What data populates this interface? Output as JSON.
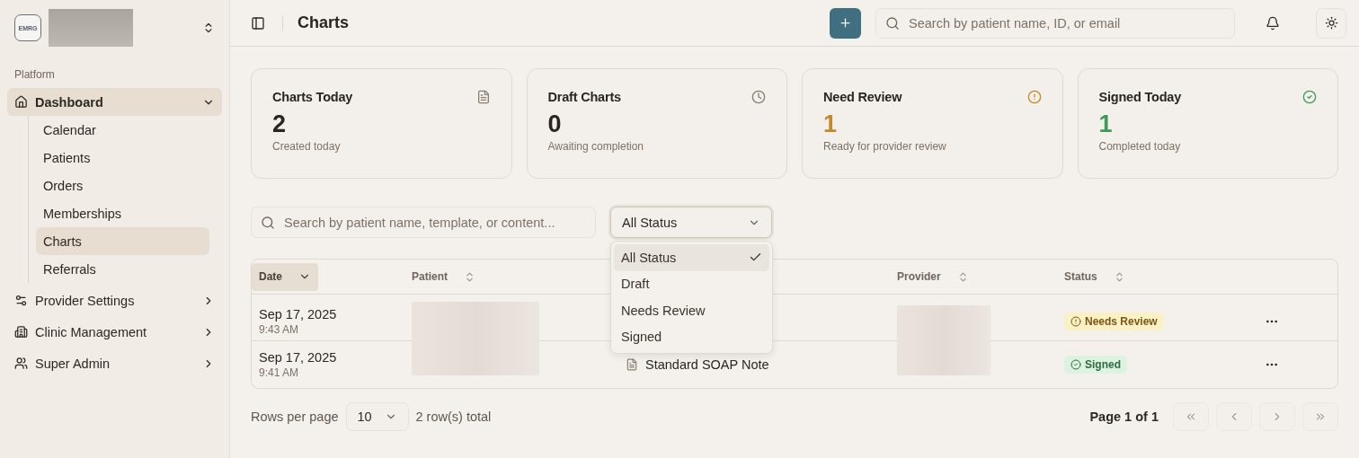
{
  "sidebar": {
    "logo": "EMRG",
    "section_label": "Platform",
    "items": [
      {
        "label": "Dashboard",
        "selected": true,
        "expanded": true,
        "children": [
          {
            "label": "Calendar",
            "selected": false
          },
          {
            "label": "Patients",
            "selected": false
          },
          {
            "label": "Orders",
            "selected": false
          },
          {
            "label": "Memberships",
            "selected": false
          },
          {
            "label": "Charts",
            "selected": true
          },
          {
            "label": "Referrals",
            "selected": false
          }
        ]
      },
      {
        "label": "Provider Settings",
        "selected": false,
        "expanded": false
      },
      {
        "label": "Clinic Management",
        "selected": false,
        "expanded": false
      },
      {
        "label": "Super Admin",
        "selected": false,
        "expanded": false
      }
    ]
  },
  "header": {
    "title": "Charts",
    "search": {
      "placeholder": "Search by patient name, ID, or email"
    }
  },
  "stats": [
    {
      "title": "Charts Today",
      "value": "2",
      "caption": "Created today",
      "color": "#2b2420"
    },
    {
      "title": "Draft Charts",
      "value": "0",
      "caption": "Awaiting completion",
      "color": "#2b2420"
    },
    {
      "title": "Need Review",
      "value": "1",
      "caption": "Ready for provider review",
      "color": "#c28a2c"
    },
    {
      "title": "Signed Today",
      "value": "1",
      "caption": "Completed today",
      "color": "#3f9a5a"
    }
  ],
  "filters": {
    "search": {
      "placeholder": "Search by patient name, template, or content..."
    },
    "status_select": {
      "value": "All Status",
      "open": true,
      "options": [
        {
          "label": "All Status",
          "selected": true
        },
        {
          "label": "Draft",
          "selected": false
        },
        {
          "label": "Needs Review",
          "selected": false
        },
        {
          "label": "Signed",
          "selected": false
        }
      ]
    }
  },
  "table": {
    "columns": [
      {
        "label": "Date",
        "sorted": true
      },
      {
        "label": "Patient",
        "sorted": false
      },
      null,
      {
        "label": "Provider",
        "sorted": false
      },
      {
        "label": "Status",
        "sorted": false
      }
    ],
    "rows": [
      {
        "date": "Sep 17, 2025",
        "time": "9:43 AM",
        "status": {
          "label": "Needs Review",
          "kind": "review"
        }
      },
      {
        "date": "Sep 17, 2025",
        "time": "9:41 AM",
        "template": "Standard SOAP Note",
        "status": {
          "label": "Signed",
          "kind": "signed"
        }
      }
    ]
  },
  "footer": {
    "rows_per_page_label": "Rows per page",
    "rows_per_page": "10",
    "total": "2 row(s) total",
    "page": "Page 1 of 1",
    "buttons": [
      {
        "kind": "first",
        "disabled": true
      },
      {
        "kind": "prev",
        "disabled": true
      },
      {
        "kind": "next",
        "disabled": true
      },
      {
        "kind": "last",
        "disabled": true
      }
    ]
  }
}
